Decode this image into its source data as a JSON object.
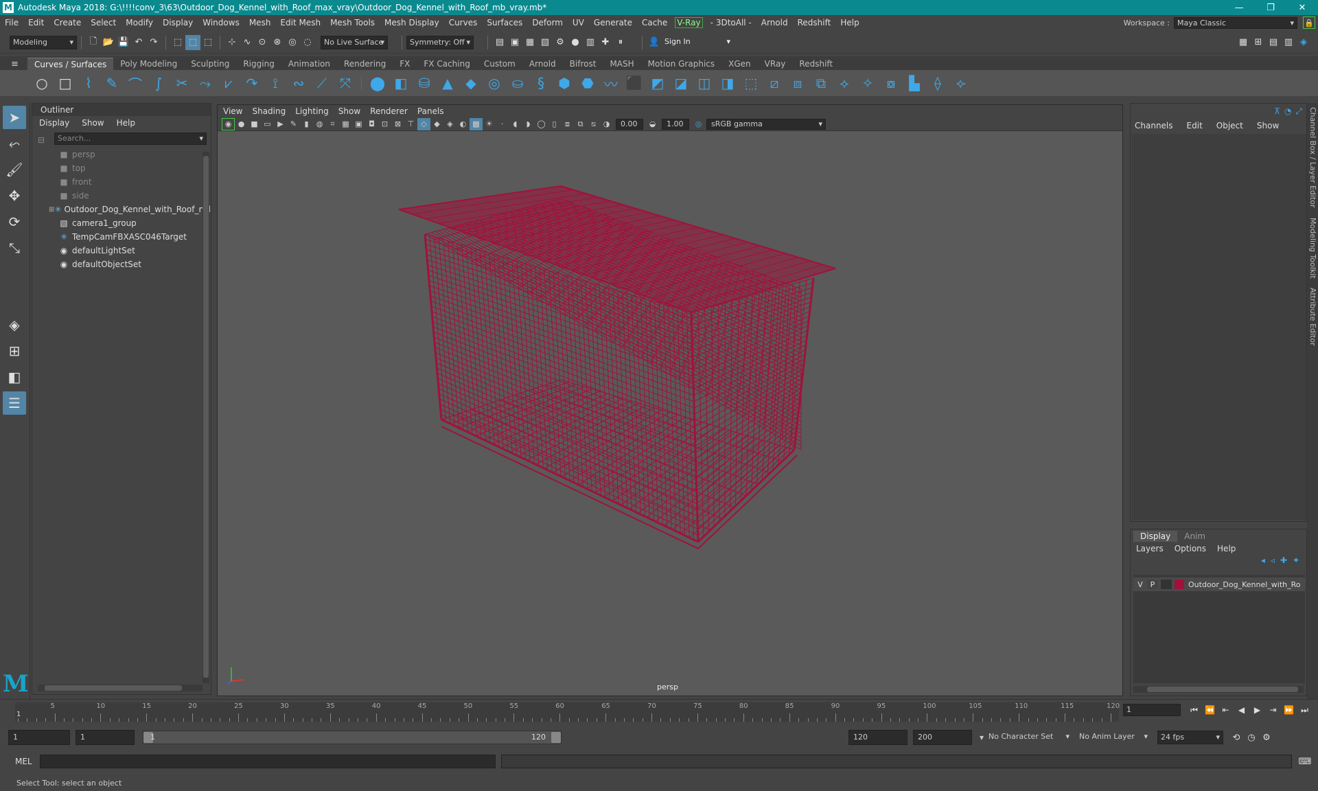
{
  "window": {
    "title": "Autodesk Maya 2018: G:\\!!!!conv_3\\63\\Outdoor_Dog_Kennel_with_Roof_max_vray\\Outdoor_Dog_Kennel_with_Roof_mb_vray.mb*",
    "logo": "M",
    "min": "—",
    "max": "❐",
    "close": "✕"
  },
  "menubar": {
    "items": [
      "File",
      "Edit",
      "Create",
      "Select",
      "Modify",
      "Display",
      "Windows",
      "Mesh",
      "Edit Mesh",
      "Mesh Tools",
      "Mesh Display",
      "Curves",
      "Surfaces",
      "Deform",
      "UV",
      "Generate",
      "Cache"
    ],
    "vray": "V-Ray",
    "items2": [
      "- 3DtoAll -",
      "Arnold",
      "Redshift",
      "Help"
    ],
    "workspace_label": "Workspace :",
    "workspace_value": "Maya Classic"
  },
  "statusline": {
    "mode": "Modeling",
    "live_surface": "No Live Surface",
    "symmetry": "Symmetry: Off",
    "sign_in": "Sign In"
  },
  "shelf": {
    "tabs": [
      "Curves / Surfaces",
      "Poly Modeling",
      "Sculpting",
      "Rigging",
      "Animation",
      "Rendering",
      "FX",
      "FX Caching",
      "Custom",
      "Arnold",
      "Bifrost",
      "MASH",
      "Motion Graphics",
      "XGen",
      "VRay",
      "Redshift"
    ],
    "active_tab": 0
  },
  "outliner": {
    "title": "Outliner",
    "menu": [
      "Display",
      "Show",
      "Help"
    ],
    "search_placeholder": "Search...",
    "items": [
      {
        "label": "persp",
        "icon": "camera-icon",
        "dim": true
      },
      {
        "label": "top",
        "icon": "camera-icon",
        "dim": true
      },
      {
        "label": "front",
        "icon": "camera-icon",
        "dim": true
      },
      {
        "label": "side",
        "icon": "camera-icon",
        "dim": true
      },
      {
        "label": "Outdoor_Dog_Kennel_with_Roof_ncl",
        "icon": "transform-icon",
        "expand": true
      },
      {
        "label": "camera1_group",
        "icon": "group-icon"
      },
      {
        "label": "TempCamFBXASC046Target",
        "icon": "transform-icon"
      },
      {
        "label": "defaultLightSet",
        "icon": "set-icon"
      },
      {
        "label": "defaultObjectSet",
        "icon": "set-icon"
      }
    ]
  },
  "viewport": {
    "menu": [
      "View",
      "Shading",
      "Lighting",
      "Show",
      "Renderer",
      "Panels"
    ],
    "exposure": "0.00",
    "gamma": "1.00",
    "color_space": "sRGB gamma",
    "camera_label": "persp",
    "wire_color": "#a0123c"
  },
  "channelbox": {
    "menu": [
      "Channels",
      "Edit",
      "Object",
      "Show"
    ],
    "side_tabs": [
      "Channel Box / Layer Editor",
      "Modeling Toolkit",
      "Attribute Editor"
    ]
  },
  "layers": {
    "tabs": [
      "Display",
      "Anim"
    ],
    "menu": [
      "Layers",
      "Options",
      "Help"
    ],
    "row": {
      "v": "V",
      "p": "P",
      "name": "Outdoor_Dog_Kennel_with_Ro",
      "color": "#a0123c"
    }
  },
  "timeline": {
    "ticks": [
      5,
      10,
      15,
      20,
      25,
      30,
      35,
      40,
      45,
      50,
      55,
      60,
      65,
      70,
      75,
      80,
      85,
      90,
      95,
      100,
      105,
      110,
      115,
      120
    ],
    "first": "1",
    "current_frame": "1"
  },
  "range": {
    "start": "1",
    "playback_start": "1",
    "range_start": "1",
    "range_end": "120",
    "playback_end": "120",
    "end": "200",
    "character_set": "No Character Set",
    "anim_layer": "No Anim Layer",
    "fps": "24 fps"
  },
  "cmdline": {
    "label": "MEL"
  },
  "helpline": {
    "text": "Select Tool: select an object"
  }
}
